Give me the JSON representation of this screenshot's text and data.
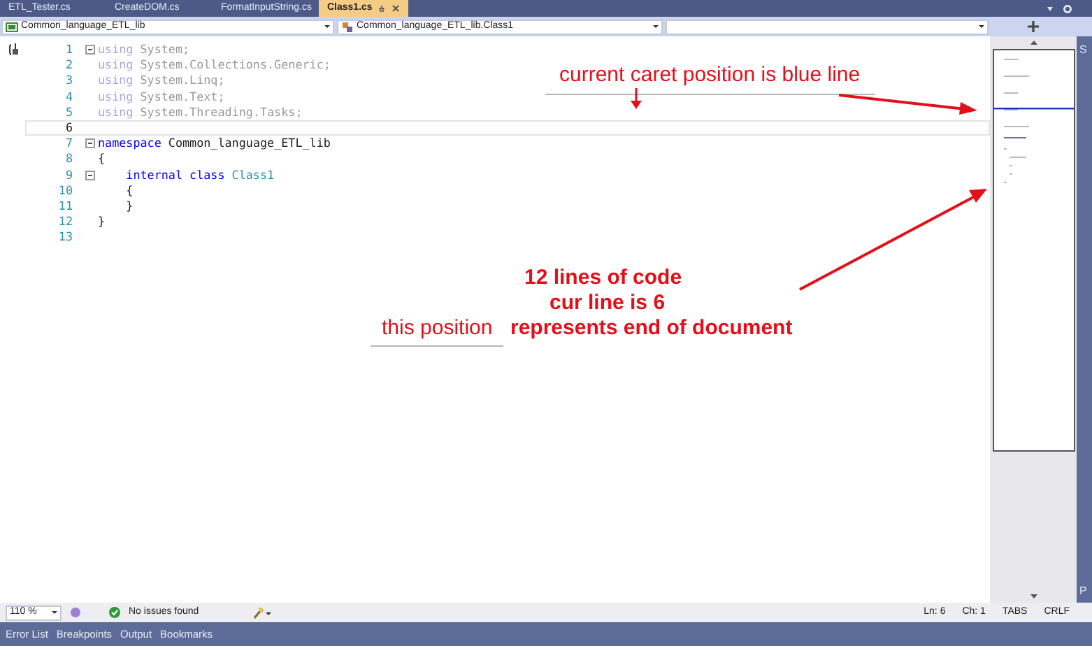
{
  "tabs": [
    {
      "label": "ETL_Tester.cs",
      "selected": false
    },
    {
      "label": "CreateDOM.cs",
      "selected": false
    },
    {
      "label": "FormatInputString.cs",
      "selected": false
    },
    {
      "label": "Class1.cs",
      "selected": true
    }
  ],
  "navigation_bar": {
    "project": "Common_language_ETL_lib",
    "type": "Common_language_ETL_lib.Class1"
  },
  "code": {
    "lines": [
      {
        "number": "1",
        "current": false,
        "foldable": true,
        "tokens": [
          {
            "text": "using",
            "kind": "faded-keyword"
          },
          {
            "text": " System;",
            "kind": "faded"
          }
        ]
      },
      {
        "number": "2",
        "current": false,
        "foldable": false,
        "tokens": [
          {
            "text": "using",
            "kind": "faded-keyword"
          },
          {
            "text": " System.Collections.Generic;",
            "kind": "faded"
          }
        ]
      },
      {
        "number": "3",
        "current": false,
        "foldable": false,
        "tokens": [
          {
            "text": "using",
            "kind": "faded-keyword"
          },
          {
            "text": " System.Linq;",
            "kind": "faded"
          }
        ]
      },
      {
        "number": "4",
        "current": false,
        "foldable": false,
        "tokens": [
          {
            "text": "using",
            "kind": "faded-keyword"
          },
          {
            "text": " System.Text;",
            "kind": "faded"
          }
        ]
      },
      {
        "number": "5",
        "current": false,
        "foldable": false,
        "tokens": [
          {
            "text": "using",
            "kind": "faded-keyword"
          },
          {
            "text": " System.Threading.Tasks;",
            "kind": "faded"
          }
        ]
      },
      {
        "number": "6",
        "current": true,
        "foldable": false
      },
      {
        "number": "7",
        "current": false,
        "foldable": true,
        "tokens": [
          {
            "text": "namespace",
            "kind": "keyword"
          },
          {
            "text": " Common_language_ETL_lib",
            "kind": "plain"
          }
        ]
      },
      {
        "number": "8",
        "current": false,
        "foldable": false,
        "tokens": [
          {
            "text": "{",
            "kind": "plain"
          }
        ]
      },
      {
        "number": "9",
        "current": false,
        "foldable": true,
        "tokens": [
          {
            "text": "    internal class",
            "kind": "keyword"
          },
          {
            "text": " Class1",
            "kind": "type"
          }
        ]
      },
      {
        "number": "10",
        "current": false,
        "foldable": false,
        "tokens": [
          {
            "text": "    {",
            "kind": "plain"
          }
        ]
      },
      {
        "number": "11",
        "current": false,
        "foldable": false,
        "tokens": [
          {
            "text": "    }",
            "kind": "plain"
          }
        ]
      },
      {
        "number": "12",
        "current": false,
        "foldable": false,
        "tokens": [
          {
            "text": "}",
            "kind": "plain"
          }
        ]
      },
      {
        "number": "13",
        "current": false,
        "foldable": false
      }
    ]
  },
  "annotations": [
    {
      "text": "current caret position is blue line",
      "bold": false
    },
    {
      "text": "12 lines of code",
      "bold": true
    },
    {
      "text": "cur line is 6",
      "bold": true
    },
    {
      "text": "this position",
      "bold": false
    },
    {
      "text": "represents end of document",
      "bold": true
    }
  ],
  "side_strip": {
    "top": "S",
    "bottom": "P"
  },
  "status_bar": {
    "zoom": "110 %",
    "issues": "No issues found",
    "line": "Ln: 6",
    "column": "Ch: 1",
    "indent": "TABS",
    "line_ending": "CRLF"
  },
  "tool_tabs": [
    "Error List",
    "Breakpoints",
    "Output",
    "Bookmarks"
  ]
}
